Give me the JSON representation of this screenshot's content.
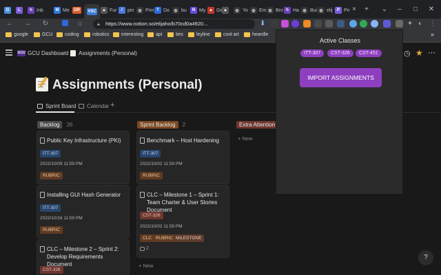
{
  "browser": {
    "tabs": [
      {
        "label": "",
        "color": "#4a90d9",
        "icon": "G"
      },
      {
        "label": "",
        "color": "#7b5bd6",
        "icon": "L"
      },
      {
        "label": "Inb",
        "color": "#6b3fb8",
        "icon": "h"
      },
      {
        "label": "Me",
        "color": "#2d7be0",
        "icon": "M"
      },
      {
        "label": "",
        "color": "#d95f2b",
        "icon": "GR"
      },
      {
        "label": "",
        "color": "#3a7bd5",
        "icon": "VSC"
      },
      {
        "label": "Fur",
        "color": "#555555",
        "icon": "▲"
      },
      {
        "label": "pin",
        "color": "#4a7ad9",
        "icon": "/"
      },
      {
        "label": "Prin",
        "color": "#333333",
        "icon": "◎"
      },
      {
        "label": "Do",
        "color": "#2b6ad9",
        "icon": "T"
      },
      {
        "label": "bu",
        "color": "#333333",
        "icon": "◎"
      },
      {
        "label": "My",
        "color": "#6b4ad9",
        "icon": "N"
      },
      {
        "label": "Ge",
        "color": "#c0392b",
        "icon": "▲"
      },
      {
        "label": "",
        "color": "#555555",
        "icon": "▲"
      },
      {
        "label": "Yo",
        "color": "#333333",
        "icon": "◎"
      },
      {
        "label": "Em",
        "color": "#333333",
        "icon": "◎"
      },
      {
        "label": "Bro",
        "color": "#333333",
        "icon": "◎"
      },
      {
        "label": "Ha",
        "color": "#6b3fb8",
        "icon": "h"
      },
      {
        "label": "Bui",
        "color": "#333333",
        "icon": "◎"
      },
      {
        "label": "elij",
        "color": "#333333",
        "icon": "◎"
      },
      {
        "label": "Pri",
        "color": "#7b5bd6",
        "icon": "P"
      }
    ],
    "url": "https://www.notion.so/elijaho/b70cd0a4920...",
    "bookmarks": [
      "google",
      "GCU",
      "coding",
      "robotics",
      "interesting",
      "api",
      "ties",
      "leyline",
      "cool art",
      "heardle"
    ]
  },
  "notion": {
    "breadcrumb": {
      "workspace": "GCU Dashboard",
      "separator": "/",
      "page": "Assignments (Personal)"
    },
    "page_title": "Assignments (Personal)",
    "views": {
      "sprint_board": "Sprint Board",
      "calendar": "Calendar",
      "add": "+"
    },
    "columns": [
      {
        "name": "Backlog",
        "count": "26",
        "color": "#4a4a4a",
        "cards": [
          {
            "title": "Public Key Infrastructure (PKI)",
            "tags": [
              {
                "label": "ITT-307",
                "kind": "itt"
              }
            ],
            "date": "2022/10/09 11:59 PM",
            "badges": [
              {
                "label": "RUBRIC",
                "kind": "rub"
              }
            ]
          },
          {
            "title": "Installing GUI Hash Generator",
            "tags": [
              {
                "label": "ITT-307",
                "kind": "itt"
              }
            ],
            "date": "2022/10/16 11:59 PM",
            "badges": [
              {
                "label": "RUBRIC",
                "kind": "rub"
              }
            ]
          },
          {
            "title": "CLC – Milestone 2 – Sprint 2: Develop Requirements Document",
            "tags": [
              {
                "label": "CST-326",
                "kind": "cst"
              }
            ],
            "date": "",
            "badges": []
          }
        ]
      },
      {
        "name": "Sprint Backlog",
        "count": "2",
        "color": "#7d4a23",
        "cards": [
          {
            "title": "Benchmark – Host Hardening",
            "tags": [
              {
                "label": "ITT-307",
                "kind": "itt"
              }
            ],
            "date": "2022/10/02 11:59 PM",
            "badges": [
              {
                "label": "RUBRIC",
                "kind": "rub"
              }
            ]
          },
          {
            "title": "CLC – Milestone 1 – Sprint 1: Team Charter & User Stories Document",
            "tags": [
              {
                "label": "CST-326",
                "kind": "cst"
              }
            ],
            "date": "2022/10/02 11:59 PM",
            "badges": [
              {
                "label": "CLC",
                "kind": "rub"
              },
              {
                "label": "RUBRIC",
                "kind": "rub"
              },
              {
                "label": "MILESTONE",
                "kind": "mil"
              }
            ],
            "comments": "2"
          }
        ],
        "new_label": "New"
      },
      {
        "name": "Extra Attention",
        "count": "",
        "color": "#6e3630",
        "cards": [],
        "new_label": "New"
      }
    ]
  },
  "popup": {
    "title": "Active Classes",
    "classes": [
      "ITT-307",
      "CST-326",
      "CST-451"
    ],
    "import_button": "IMPORT ASSIGNMENTS"
  },
  "help": "?"
}
